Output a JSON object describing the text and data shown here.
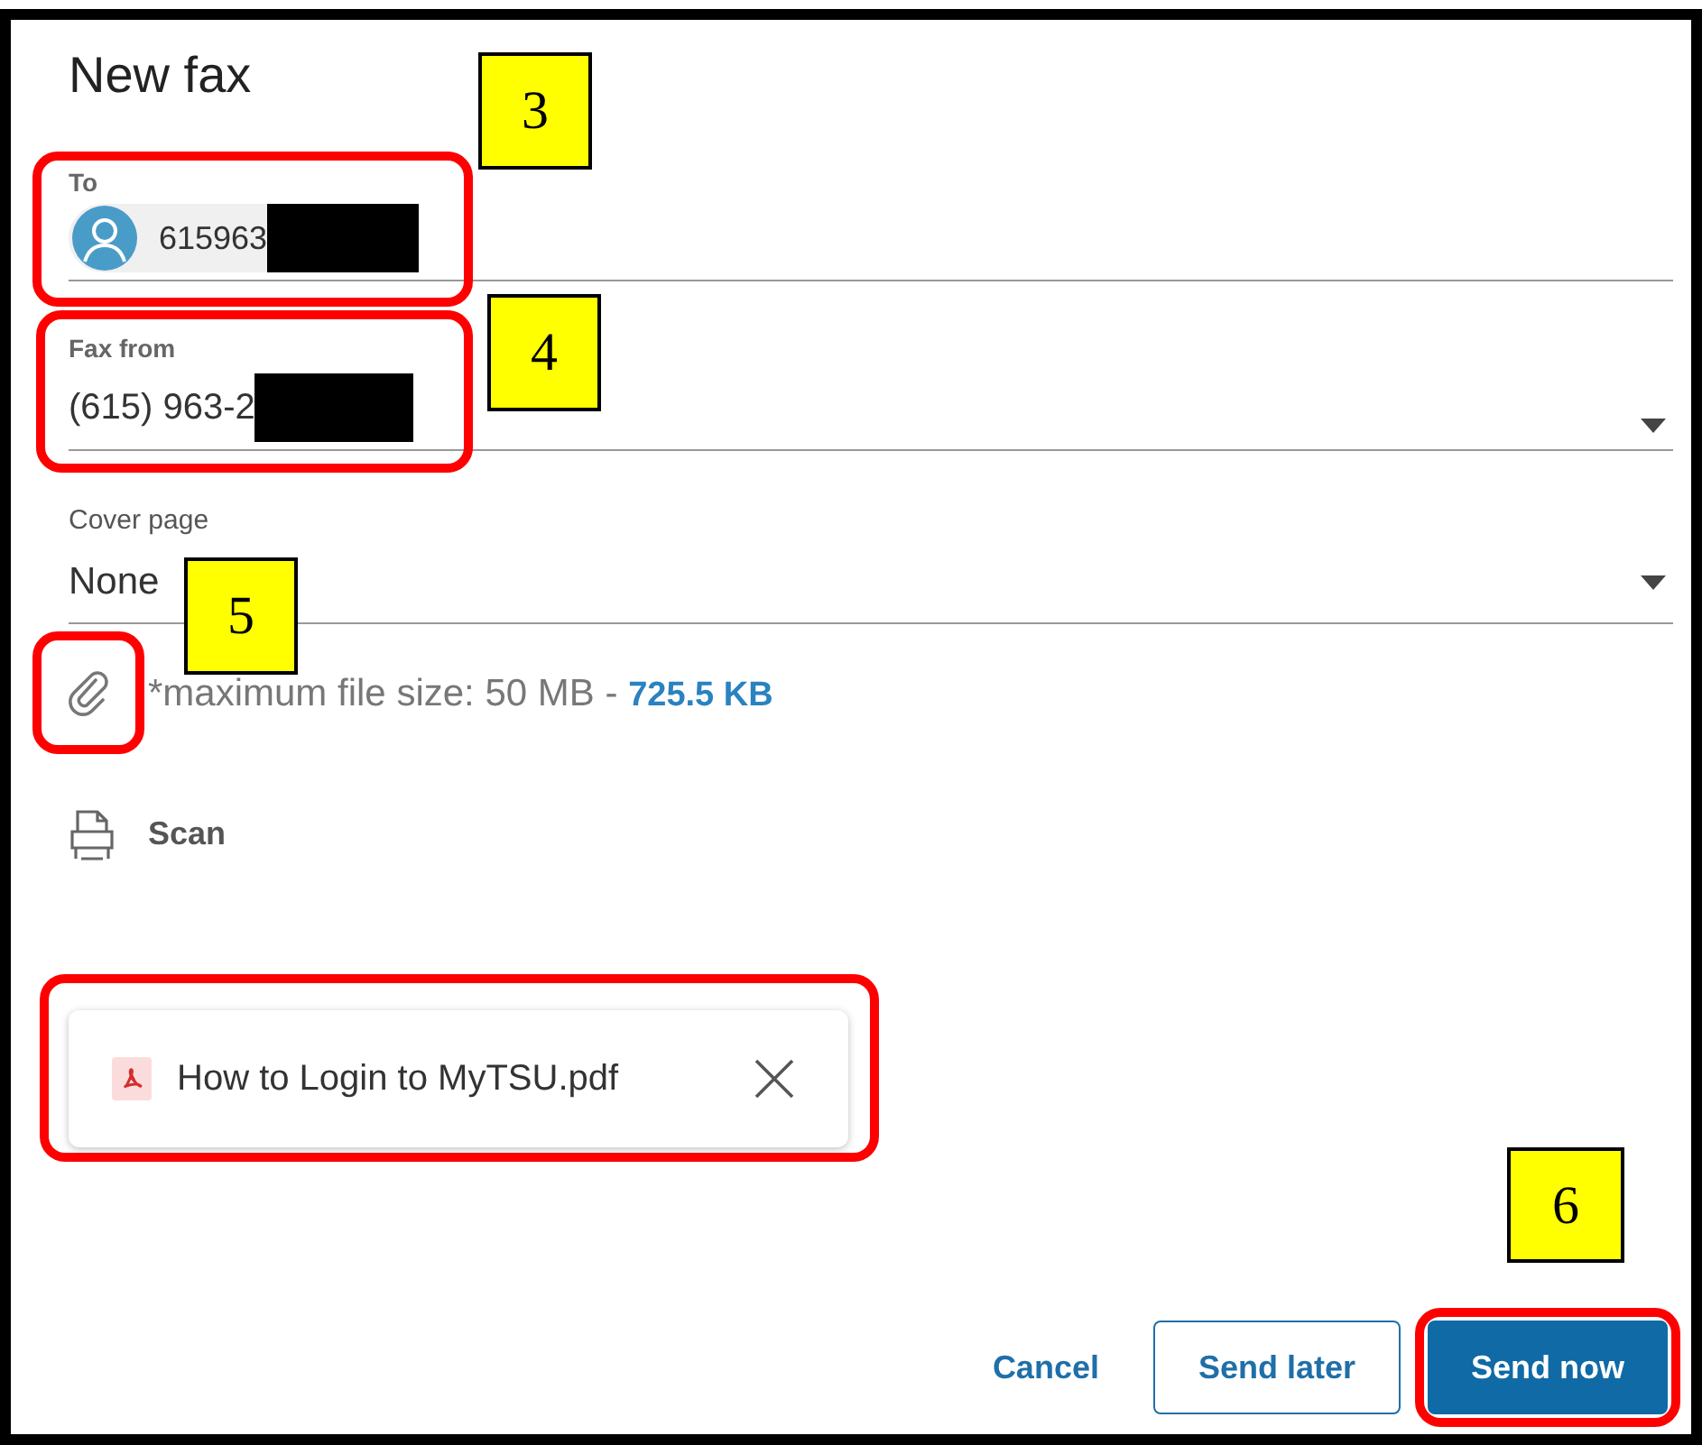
{
  "dialog": {
    "title": "New fax"
  },
  "to": {
    "label": "To",
    "value": "615963",
    "redacted": true
  },
  "fax_from": {
    "label": "Fax from",
    "value": "(615) 963-2",
    "redacted": true
  },
  "cover_page": {
    "label": "Cover page",
    "value": "None"
  },
  "attach": {
    "note": "*maximum file size: 50 MB - ",
    "size": "725.5 KB"
  },
  "scan": {
    "label": "Scan"
  },
  "attachments": [
    {
      "name": "How to Login to MyTSU.pdf"
    }
  ],
  "buttons": [
    {
      "label": "Cancel",
      "kind": "text"
    },
    {
      "label": "Send later",
      "kind": "outline"
    },
    {
      "label": "Send now",
      "kind": "primary"
    }
  ],
  "callouts": [
    {
      "label": "3"
    },
    {
      "label": "4"
    },
    {
      "label": "5"
    },
    {
      "label": "6"
    }
  ]
}
